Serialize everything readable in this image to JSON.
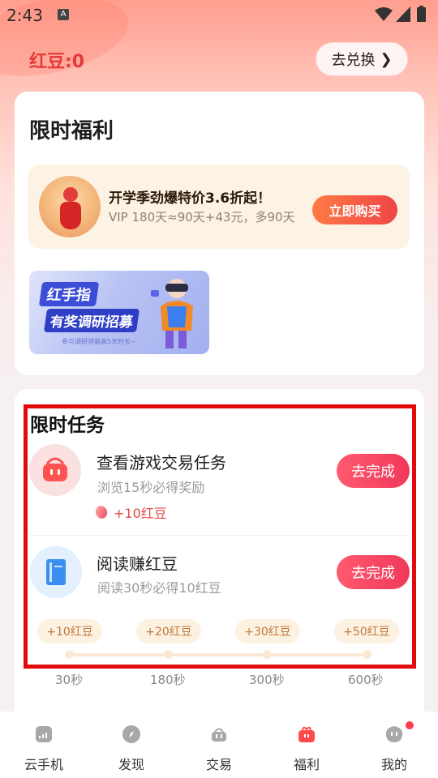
{
  "status": {
    "time": "2:43",
    "notif_letter": "A"
  },
  "header": {
    "beans_label": "红豆:0",
    "exchange_label": "去兑换",
    "exchange_chevron": "❯"
  },
  "benefits": {
    "title": "限时福利",
    "promo": {
      "headline": "开学季劲爆特价3.6折起！",
      "subline": "VIP 180天≈90天+43元，多90天",
      "buy_label": "立即购买"
    },
    "banner": {
      "line1": "红手指",
      "line2": "有奖调研招募",
      "line3": "参与调研领最高5天时长~"
    }
  },
  "tasks": {
    "title": "限时任务",
    "items": [
      {
        "name": "查看游戏交易任务",
        "desc": "浏览15秒必得奖励",
        "reward": "+10红豆",
        "button": "去完成",
        "icon": "shopping-basket-icon"
      },
      {
        "name": "阅读赚红豆",
        "desc": "阅读30秒必得10红豆",
        "button": "去完成",
        "icon": "book-icon"
      }
    ],
    "milestones": [
      {
        "reward": "+10红豆",
        "time": "30秒"
      },
      {
        "reward": "+20红豆",
        "time": "180秒"
      },
      {
        "reward": "+30红豆",
        "time": "300秒"
      },
      {
        "reward": "+50红豆",
        "time": "600秒"
      }
    ]
  },
  "tabbar": {
    "items": [
      {
        "label": "云手机",
        "icon": "cloud-phone-icon"
      },
      {
        "label": "发现",
        "icon": "compass-icon"
      },
      {
        "label": "交易",
        "icon": "basket-icon"
      },
      {
        "label": "福利",
        "icon": "gift-icon",
        "active": true
      },
      {
        "label": "我的",
        "icon": "profile-icon",
        "badge": true
      }
    ]
  },
  "colors": {
    "accent": "#f0385a",
    "beans": "#e63a3a",
    "highlight_box": "#e10b0b"
  }
}
